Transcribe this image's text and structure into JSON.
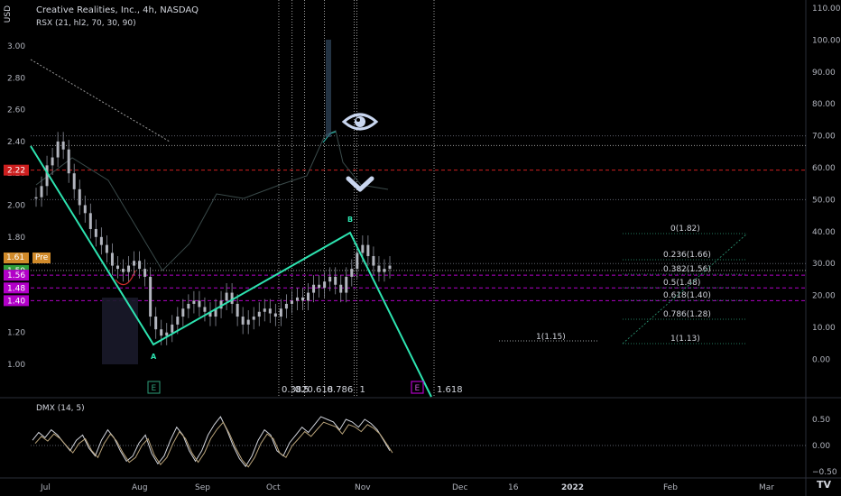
{
  "header": {
    "currency": "USD",
    "symbol_title": "Creative Realities, Inc., 4h, NASDAQ",
    "indicator_main": "RSX (21, hl2, 70, 30, 90)",
    "indicator_sub": "DMX (14, 5)"
  },
  "price_axis": {
    "ticks": [
      "3.00",
      "2.80",
      "2.60",
      "2.40",
      "2.20",
      "2.00",
      "1.80",
      "1.60",
      "1.40",
      "1.20",
      "1.00"
    ],
    "tick_values": [
      3.0,
      2.8,
      2.6,
      2.4,
      2.2,
      2.0,
      1.8,
      1.6,
      1.4,
      1.2,
      1.0
    ],
    "tags": [
      {
        "label": "2.22",
        "value": 2.22,
        "color": "#cc1f1f"
      },
      {
        "label": "1.59",
        "value": 1.59,
        "color": "#2e9e3a"
      },
      {
        "label": "1.56",
        "value": 1.56,
        "color": "#b200c8"
      },
      {
        "label": "1.48",
        "value": 1.48,
        "color": "#b200c8"
      },
      {
        "label": "1.40",
        "value": 1.4,
        "color": "#b200c8"
      }
    ],
    "badge_left": "1.61",
    "badge_right": "Pre"
  },
  "rsx_axis": {
    "ticks": [
      "110.00",
      "100.00",
      "90.00",
      "80.00",
      "70.00",
      "60.00",
      "50.00",
      "40.00",
      "30.00",
      "20.00",
      "10.00",
      "0.00"
    ],
    "tick_values": [
      110,
      100,
      90,
      80,
      70,
      60,
      50,
      40,
      30,
      20,
      10,
      0
    ]
  },
  "dmx_axis": {
    "ticks": [
      "0.50",
      "0.00",
      "−0.50"
    ],
    "tick_values": [
      0.5,
      0.0,
      -0.5
    ]
  },
  "time_axis": {
    "labels": [
      "Jul",
      "Aug",
      "Sep",
      "Oct",
      "Nov",
      "Dec",
      "16",
      "2022",
      "Feb",
      "Mar"
    ],
    "positions": [
      0.8,
      1.8,
      2.8,
      3.8,
      4.8,
      5.8,
      6.3,
      6.8,
      7.8,
      8.8
    ]
  },
  "chart_data": {
    "type": "line",
    "title": "Creative Realities, Inc., 4h, NASDAQ",
    "ylabel": "USD",
    "ylim": [
      0.85,
      3.1
    ],
    "zigzag": {
      "points": [
        {
          "x": 0.72,
          "y": 2.38,
          "label": ""
        },
        {
          "x": 2.05,
          "y": 1.13,
          "label": "A"
        },
        {
          "x": 4.72,
          "y": 1.82,
          "label": "B"
        },
        {
          "x": 5.55,
          "y": 0.85,
          "label": ""
        }
      ]
    },
    "fib_time": {
      "labels": [
        "0.382",
        "0.5",
        "0.618",
        "0.786",
        "1",
        "1.618"
      ],
      "values": [
        3.68,
        3.84,
        3.99,
        4.23,
        4.62,
        5.55
      ]
    },
    "fib_levels": [
      {
        "label": "0(1.82)",
        "value": 1.82
      },
      {
        "label": "0.236(1.66)",
        "value": 1.66
      },
      {
        "label": "0.382(1.56)",
        "value": 1.56
      },
      {
        "label": "0.5(1.48)",
        "value": 1.48
      },
      {
        "label": "0.618(1.40)",
        "value": 1.4
      },
      {
        "label": "0.786(1.28)",
        "value": 1.28
      },
      {
        "label": "1(1.13)",
        "value": 1.13
      }
    ],
    "projection_label": {
      "label": "1(1.15)",
      "value": 1.15
    },
    "horizontal_lines": [
      {
        "value": 2.22,
        "color": "#cc1f1f"
      },
      {
        "value": 1.59,
        "color": "#9a9a9a"
      },
      {
        "value": 1.56,
        "color": "#b200c8"
      },
      {
        "value": 1.48,
        "color": "#b200c8"
      },
      {
        "value": 1.4,
        "color": "#b200c8"
      }
    ],
    "candles_close": [
      2.05,
      2.12,
      2.25,
      2.3,
      2.4,
      2.35,
      2.2,
      2.1,
      2.0,
      1.95,
      1.85,
      1.8,
      1.75,
      1.7,
      1.62,
      1.6,
      1.58,
      1.62,
      1.65,
      1.6,
      1.55,
      1.3,
      1.22,
      1.18,
      1.2,
      1.25,
      1.3,
      1.35,
      1.38,
      1.4,
      1.36,
      1.33,
      1.3,
      1.35,
      1.4,
      1.45,
      1.38,
      1.3,
      1.25,
      1.28,
      1.3,
      1.33,
      1.35,
      1.32,
      1.3,
      1.35,
      1.38,
      1.4,
      1.42,
      1.4,
      1.45,
      1.5,
      1.48,
      1.52,
      1.55,
      1.5,
      1.45,
      1.55,
      1.6,
      1.7,
      1.75,
      1.68,
      1.62,
      1.58,
      1.6,
      1.62
    ],
    "dmx_values": [
      0.1,
      0.25,
      0.15,
      0.3,
      0.2,
      0.05,
      -0.1,
      0.1,
      0.2,
      -0.05,
      -0.2,
      0.1,
      0.3,
      0.15,
      -0.1,
      -0.3,
      -0.2,
      0.05,
      0.2,
      -0.15,
      -0.35,
      -0.2,
      0.1,
      0.35,
      0.2,
      -0.1,
      -0.3,
      -0.1,
      0.2,
      0.4,
      0.55,
      0.3,
      0.0,
      -0.25,
      -0.4,
      -0.2,
      0.1,
      0.3,
      0.2,
      -0.1,
      -0.2,
      0.05,
      0.2,
      0.35,
      0.25,
      0.4,
      0.55,
      0.5,
      0.45,
      0.3,
      0.5,
      0.45,
      0.35,
      0.5,
      0.42,
      0.3,
      0.1,
      -0.1
    ]
  },
  "markers": {
    "eye_icon": "eye-icon",
    "chevron_icon": "chevron-down-icon",
    "e_badge_1": "E",
    "e_badge_2": "E"
  },
  "logo": "TV"
}
